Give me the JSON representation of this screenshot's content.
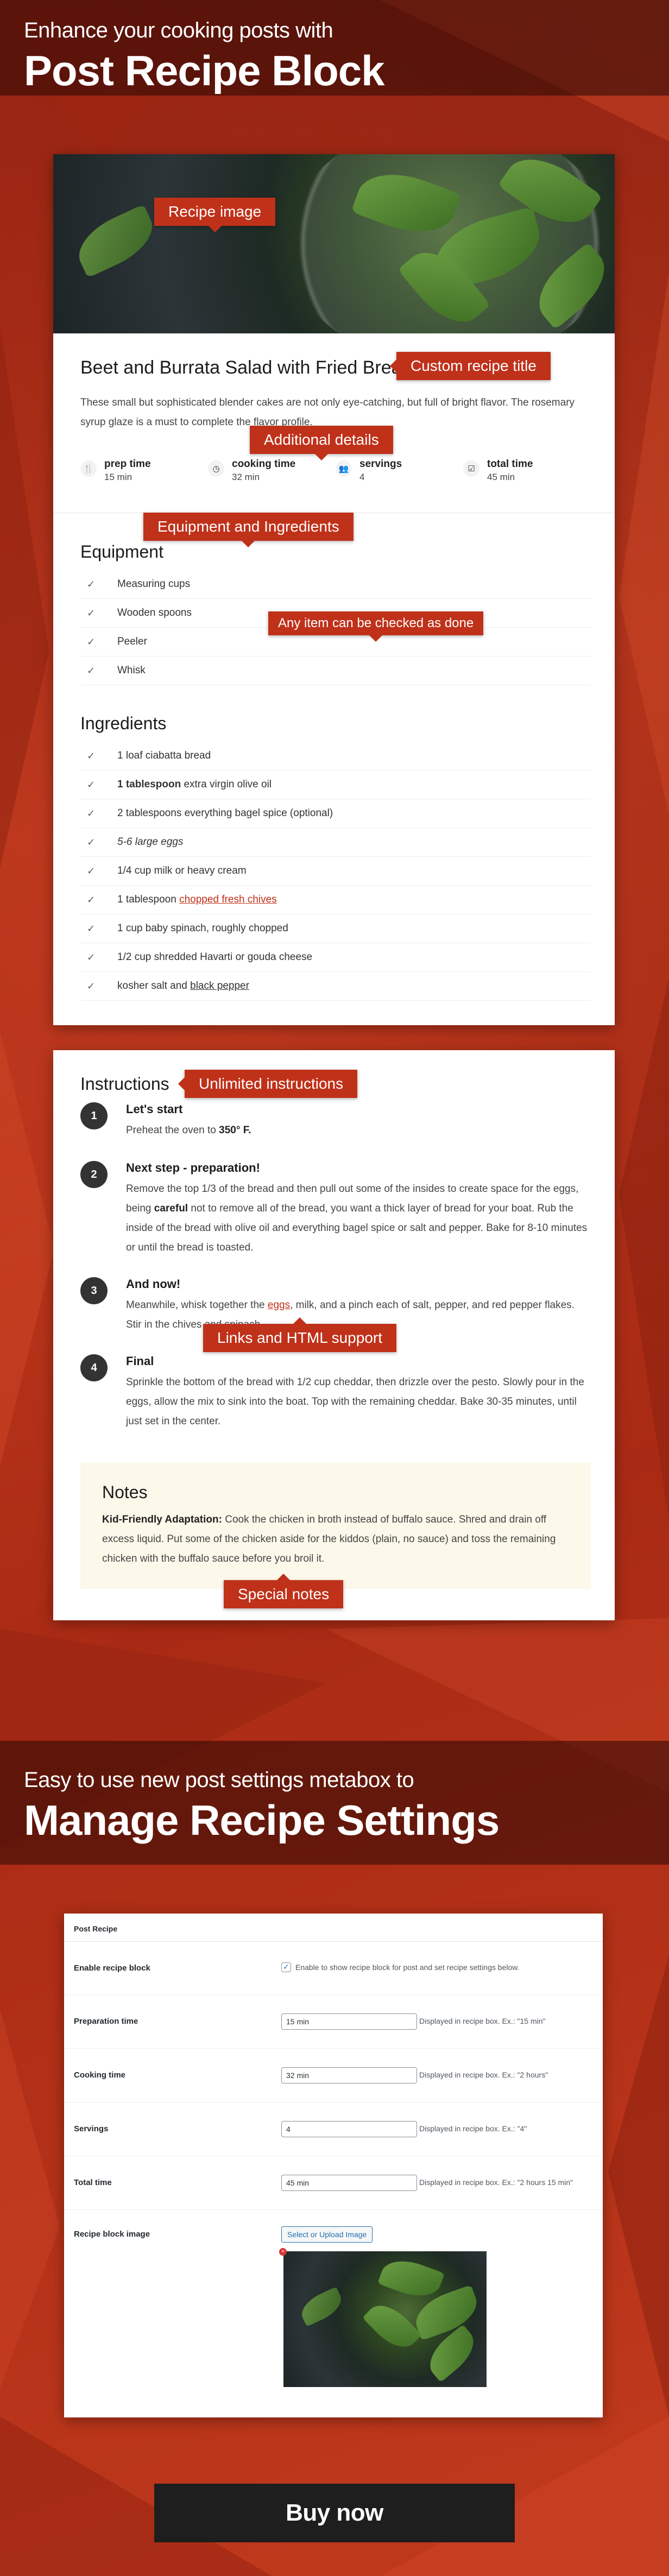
{
  "header": {
    "subtitle": "Enhance your cooking posts with",
    "title": "Post Recipe Block"
  },
  "recipe": {
    "title": "Beet and Burrata Salad with Fried Bread",
    "description": "These small but sophisticated blender cakes are not only eye-catching, but full of bright flavor. The rosemary syrup glaze is a must to complete the flavor profile.",
    "meta": [
      {
        "icon": "utensils-icon",
        "label": "prep time",
        "value": "15 min"
      },
      {
        "icon": "clock-icon",
        "label": "cooking time",
        "value": "32 min"
      },
      {
        "icon": "people-icon",
        "label": "servings",
        "value": "4"
      },
      {
        "icon": "calendar-check-icon",
        "label": "total time",
        "value": "45 min"
      }
    ],
    "equipment_heading": "Equipment",
    "equipment": [
      "Measuring cups",
      "Wooden spoons",
      "Peeler",
      "Whisk"
    ],
    "ingredients_heading": "Ingredients",
    "ingredients": [
      {
        "pre": "1 loaf ciabatta bread"
      },
      {
        "bold": "1 tablespoon",
        "post": " extra virgin olive oil"
      },
      {
        "pre": "2 tablespoons everything bagel spice (optional)"
      },
      {
        "italic": "5-6 large eggs"
      },
      {
        "pre": "1/4 cup milk or heavy cream"
      },
      {
        "pre": "1 tablespoon ",
        "link": "chopped fresh chives"
      },
      {
        "pre": "1 cup baby spinach, roughly chopped"
      },
      {
        "pre": "1/2 cup shredded Havarti or gouda cheese"
      },
      {
        "pre": "kosher salt and ",
        "underline": "black pepper"
      }
    ]
  },
  "callouts": {
    "recipe_image": "Recipe image",
    "custom_title": "Custom recipe title",
    "additional_details": "Additional details",
    "equipment_ingredients": "Equipment and Ingredients",
    "checked_done": "Any item can be checked as done",
    "unlimited_instructions": "Unlimited instructions",
    "links_html": "Links and HTML support",
    "special_notes": "Special notes"
  },
  "instructions": {
    "heading": "Instructions",
    "steps": [
      {
        "num": "1",
        "title": "Let's start",
        "body_pre": "Preheat the oven to ",
        "body_bold": "350° F.",
        "body_post": ""
      },
      {
        "num": "2",
        "title": "Next step - preparation!",
        "body_pre": "Remove the top 1/3 of the bread and then pull out some of the insides to create space for the eggs, being ",
        "body_bold": "careful",
        "body_post": " not to remove all of the bread, you want a thick layer of bread for your boat. Rub the inside of the bread with olive oil and everything bagel spice or salt and pepper. Bake for 8-10 minutes or until the bread is toasted."
      },
      {
        "num": "3",
        "title": "And now!",
        "body_pre": "Meanwhile, whisk together the ",
        "body_link": "eggs",
        "body_post": ", milk, and a pinch each of salt, pepper, and red pepper flakes. Stir in the chives and spinach."
      },
      {
        "num": "4",
        "title": "Final",
        "body_pre": "Sprinkle the bottom of the bread with 1/2 cup cheddar, then drizzle over the pesto. Slowly pour in the eggs, allow the mix to sink into the boat. Top with the remaining cheddar. Bake 30-35 minutes, until just set in the center.",
        "body_bold": "",
        "body_post": ""
      }
    ]
  },
  "notes": {
    "heading": "Notes",
    "bold": "Kid-Friendly Adaptation:",
    "text": " Cook the chicken in broth instead of buffalo sauce. Shred and drain off excess liquid. Put some of the chicken aside for the kiddos (plain, no sauce) and toss the remaining chicken with the buffalo sauce before you broil it."
  },
  "settings_band": {
    "subtitle": "Easy to use new post settings metabox to",
    "title": "Manage Recipe Settings"
  },
  "settings": {
    "box_title": "Post Recipe",
    "enable_label": "Enable recipe block",
    "enable_checked": true,
    "enable_hint": "Enable to show recipe block for post and set recipe settings below.",
    "fields": [
      {
        "label": "Preparation time",
        "value": "15 min",
        "hint": "Displayed in recipe box. Ex.: \"15 min\""
      },
      {
        "label": "Cooking time",
        "value": "32 min",
        "hint": "Displayed in recipe box. Ex.: \"2 hours\""
      },
      {
        "label": "Servings",
        "value": "4",
        "hint": "Displayed in recipe box. Ex.: \"4\""
      },
      {
        "label": "Total time",
        "value": "45 min",
        "hint": "Displayed in recipe box. Ex.: \"2 hours 15 min\""
      }
    ],
    "image_label": "Recipe block image",
    "image_button": "Select or Upload Image",
    "remove_glyph": "×"
  },
  "cta": {
    "buy_label": "Buy now"
  },
  "colors": {
    "accent": "#c0311a",
    "background": "#b8321a",
    "card": "#ffffff",
    "notes_bg": "#fcf8ea",
    "button_dark": "#1e1e1e"
  }
}
